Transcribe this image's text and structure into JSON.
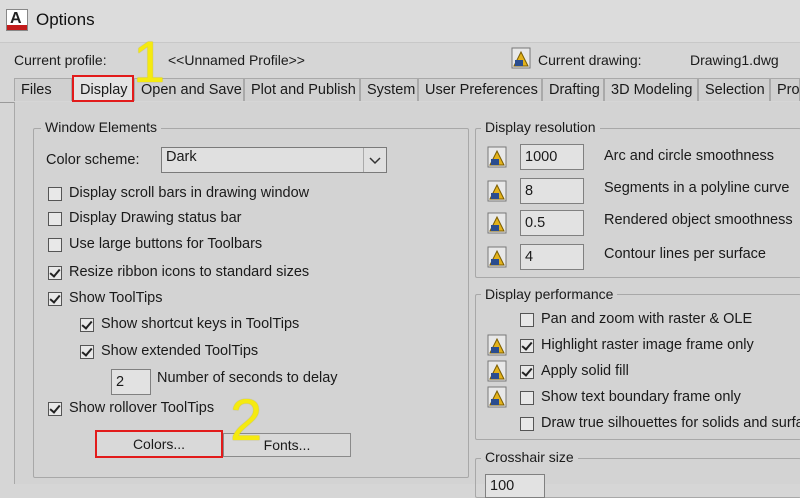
{
  "window": {
    "title": "Options"
  },
  "profile": {
    "label": "Current profile:",
    "value": "<<Unnamed Profile>>"
  },
  "drawing": {
    "label": "Current drawing:",
    "value": "Drawing1.dwg"
  },
  "tabs": [
    {
      "label": "Files"
    },
    {
      "label": "Display"
    },
    {
      "label": "Open and Save"
    },
    {
      "label": "Plot and Publish"
    },
    {
      "label": "System"
    },
    {
      "label": "User Preferences"
    },
    {
      "label": "Drafting"
    },
    {
      "label": "3D Modeling"
    },
    {
      "label": "Selection"
    },
    {
      "label": "Prof"
    }
  ],
  "annotations": {
    "step1": "1",
    "step2": "2"
  },
  "window_elements": {
    "title": "Window Elements",
    "color_scheme_label": "Color scheme:",
    "color_scheme_value": "Dark",
    "checkboxes": [
      {
        "label": "Display scroll bars in drawing window",
        "checked": false
      },
      {
        "label": "Display Drawing status bar",
        "checked": false
      },
      {
        "label": "Use large buttons for Toolbars",
        "checked": false
      },
      {
        "label": "Resize ribbon icons to standard sizes",
        "checked": true
      },
      {
        "label": "Show ToolTips",
        "checked": true
      },
      {
        "label": "Show shortcut keys in ToolTips",
        "checked": true
      },
      {
        "label": "Show extended ToolTips",
        "checked": true
      }
    ],
    "delay_value": "2",
    "delay_label": "Number of seconds to delay",
    "rollover": {
      "label": "Show rollover ToolTips",
      "checked": true
    },
    "colors_button": "Colors...",
    "fonts_button": "Fonts..."
  },
  "display_resolution": {
    "title": "Display resolution",
    "rows": [
      {
        "value": "1000",
        "label": "Arc and circle smoothness"
      },
      {
        "value": "8",
        "label": "Segments in a polyline curve"
      },
      {
        "value": "0.5",
        "label": "Rendered object smoothness"
      },
      {
        "value": "4",
        "label": "Contour lines per surface"
      }
    ]
  },
  "display_performance": {
    "title": "Display performance",
    "checkboxes": [
      {
        "label": "Pan and zoom with raster & OLE",
        "checked": false
      },
      {
        "label": "Highlight raster image frame only",
        "checked": true
      },
      {
        "label": "Apply solid fill",
        "checked": true
      },
      {
        "label": "Show text boundary frame only",
        "checked": false
      },
      {
        "label": "Draw true silhouettes for solids and surfac",
        "checked": false
      }
    ]
  },
  "crosshair": {
    "title": "Crosshair size",
    "value": "100"
  }
}
